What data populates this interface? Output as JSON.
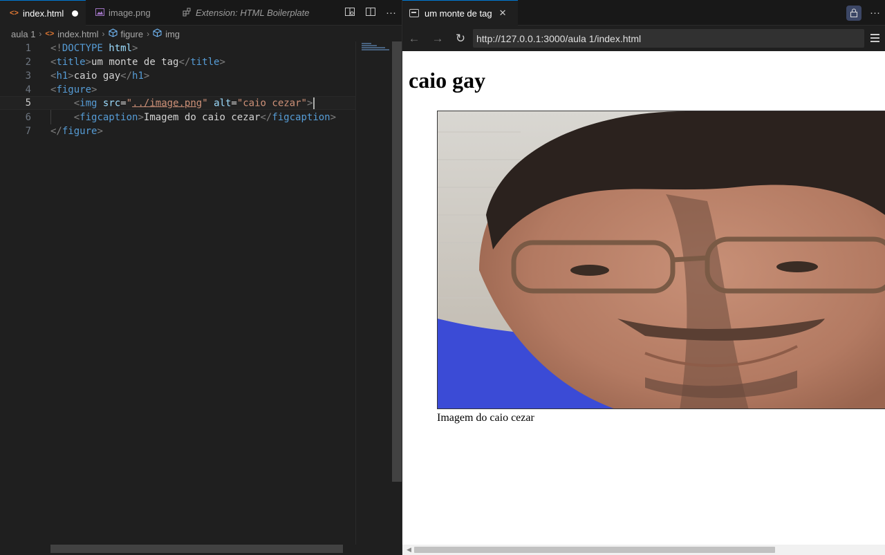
{
  "editor": {
    "tabs": [
      {
        "label": "index.html",
        "icon": "html-file-icon"
      },
      {
        "label": "image.png",
        "icon": "image-file-icon"
      },
      {
        "label": "Extension: HTML Boilerplate",
        "icon": "extension-icon"
      }
    ],
    "breadcrumb": [
      "aula 1",
      "index.html",
      "figure",
      "img"
    ],
    "code_lines": [
      {
        "num": "1"
      },
      {
        "num": "2"
      },
      {
        "num": "3"
      },
      {
        "num": "4"
      },
      {
        "num": "5"
      },
      {
        "num": "6"
      },
      {
        "num": "7"
      }
    ],
    "code": {
      "l1_a": "<!",
      "l1_b": "DOCTYPE",
      "l1_c": " html",
      "l1_d": ">",
      "l2_tag": "title",
      "l2_text": "um monte de tag",
      "l3_tag": "h1",
      "l3_text": "caio gay",
      "l4_tag": "figure",
      "l5_tag": "img",
      "l5_attr1": "src",
      "l5_val1": "../image.png",
      "l5_attr2": "alt",
      "l5_val2": "\"caio cezar\"",
      "l6_tag": "figcaption",
      "l6_text": "Imagem do caio cezar",
      "l7_tag": "figure"
    }
  },
  "browser": {
    "tab_title": "um monte de tag",
    "url": "http://127.0.0.1:3000/aula 1/index.html",
    "page": {
      "h1": "caio gay",
      "figcaption": "Imagem do caio cezar",
      "image_alt": "caio cezar"
    }
  },
  "colors": {
    "accent": "#0078d4",
    "editor_bg": "#1f1f1f",
    "tag": "#569cd6",
    "attr": "#9cdcfe",
    "string": "#ce9178"
  }
}
